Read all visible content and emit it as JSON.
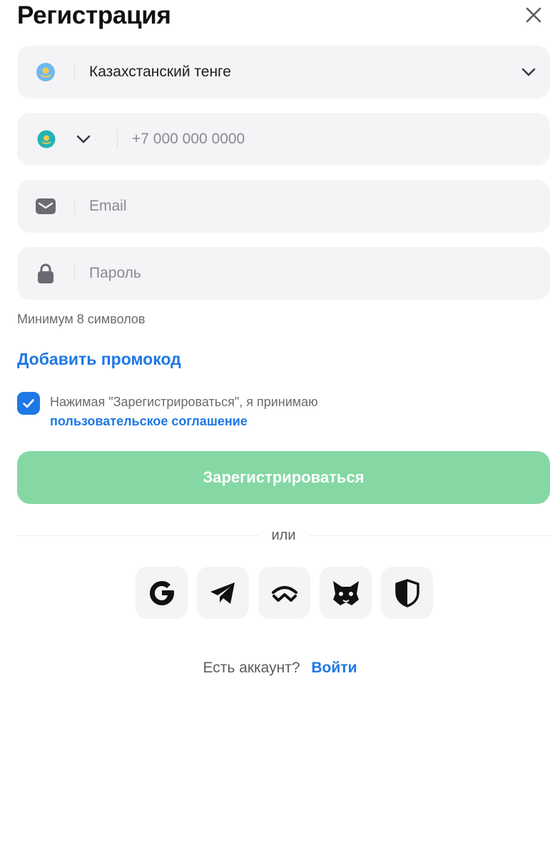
{
  "header": {
    "title": "Регистрация"
  },
  "currency": {
    "value": "Казахстанский тенге"
  },
  "phone": {
    "placeholder": "+7 000 000 0000"
  },
  "email": {
    "placeholder": "Email"
  },
  "password": {
    "placeholder": "Пароль",
    "hint": "Минимум 8 символов"
  },
  "promo": {
    "label": "Добавить промокод"
  },
  "agreement": {
    "checked": true,
    "text": "Нажимая \"Зарегистрироваться\", я принимаю",
    "link": "пользовательское соглашение"
  },
  "submit": {
    "label": "Зарегистрироваться"
  },
  "divider": {
    "text": "или"
  },
  "socials": [
    "google-icon",
    "telegram-icon",
    "walletconnect-icon",
    "metamask-icon",
    "shield-icon"
  ],
  "footer": {
    "question": "Есть аккаунт?",
    "login": "Войти"
  },
  "colors": {
    "accent": "#1e78e6",
    "submit_bg": "#85d8a4",
    "field_bg": "#f4f4f6"
  }
}
